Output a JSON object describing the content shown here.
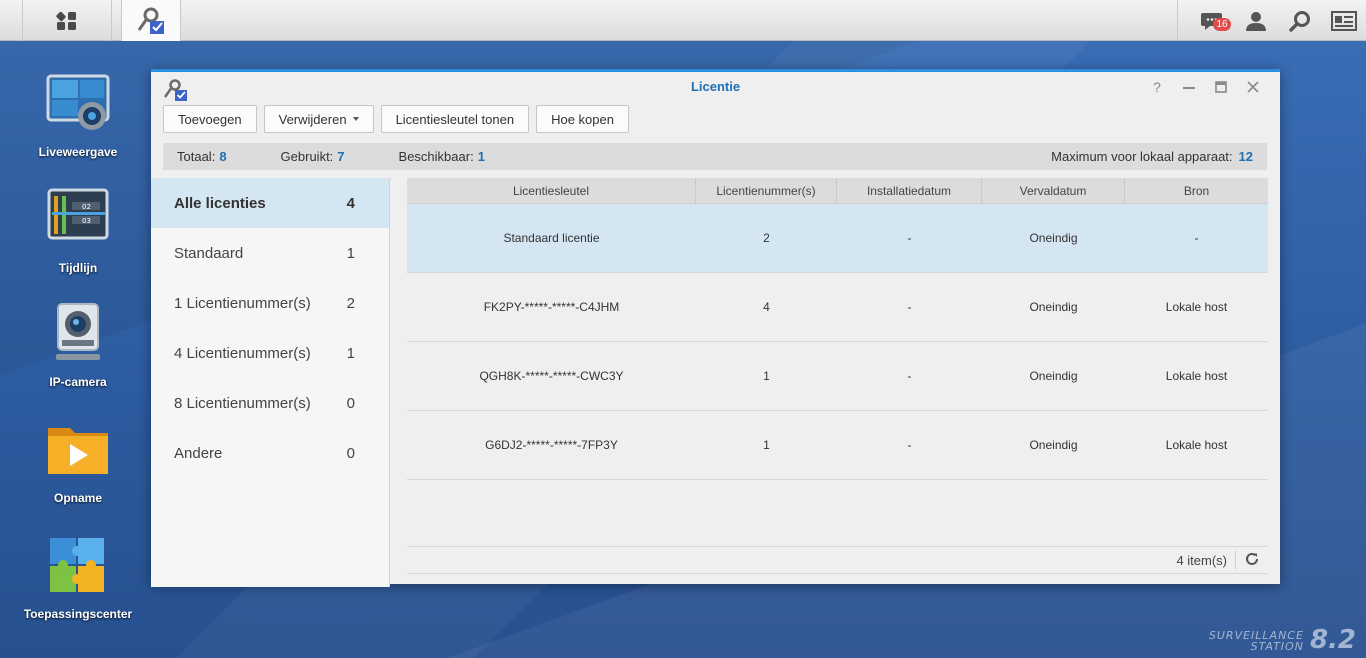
{
  "taskbar": {
    "notification_count": "16",
    "icons": [
      "main-menu-icon",
      "license-app-icon",
      "notification-icon",
      "user-icon",
      "search-icon",
      "widget-icon"
    ]
  },
  "desktop": {
    "icons": [
      {
        "label": "Liveweergave",
        "icon": "live-view-icon"
      },
      {
        "label": "Tijdlijn",
        "icon": "timeline-icon"
      },
      {
        "label": "IP-camera",
        "icon": "ip-camera-icon"
      },
      {
        "label": "Opname",
        "icon": "recording-icon"
      },
      {
        "label": "Toepassingscenter",
        "icon": "application-center-icon"
      }
    ]
  },
  "window": {
    "title": "Licentie",
    "controls": [
      "help-icon",
      "minimize-icon",
      "maximize-icon",
      "close-icon"
    ],
    "toolbar": {
      "add": "Toevoegen",
      "delete": "Verwijderen",
      "show_key": "Licentiesleutel tonen",
      "how_buy": "Hoe kopen"
    },
    "summary": {
      "total_label": "Totaal:",
      "total": "8",
      "used_label": "Gebruikt:",
      "used": "7",
      "available_label": "Beschikbaar:",
      "available": "1",
      "max_label": "Maximum voor lokaal apparaat:",
      "max": "12"
    },
    "categories": [
      {
        "label": "Alle licenties",
        "count": "4"
      },
      {
        "label": "Standaard",
        "count": "1"
      },
      {
        "label": "1 Licentienummer(s)",
        "count": "2"
      },
      {
        "label": "4 Licentienummer(s)",
        "count": "1"
      },
      {
        "label": "8 Licentienummer(s)",
        "count": "0"
      },
      {
        "label": "Andere",
        "count": "0"
      }
    ],
    "columns": [
      "Licentiesleutel",
      "Licentienummer(s)",
      "Installatiedatum",
      "Vervaldatum",
      "Bron"
    ],
    "rows": [
      {
        "key": "Standaard licentie",
        "number": "2",
        "install": "-",
        "expire": "Oneindig",
        "source": "-"
      },
      {
        "key": "FK2PY-*****-*****-C4JHM",
        "number": "4",
        "install": "-",
        "expire": "Oneindig",
        "source": "Lokale host"
      },
      {
        "key": "QGH8K-*****-*****-CWC3Y",
        "number": "1",
        "install": "-",
        "expire": "Oneindig",
        "source": "Lokale host"
      },
      {
        "key": "G6DJ2-*****-*****-7FP3Y",
        "number": "1",
        "install": "-",
        "expire": "Oneindig",
        "source": "Lokale host"
      }
    ],
    "footer": {
      "items": "4 item(s)"
    }
  },
  "brand": {
    "line1": "SURVEILLANCE",
    "line2": "STATION",
    "version": "8.2"
  },
  "colors": {
    "accent": "#1f6fb5",
    "selection": "#d4e6f2",
    "window_border": "#2a8fe0"
  }
}
